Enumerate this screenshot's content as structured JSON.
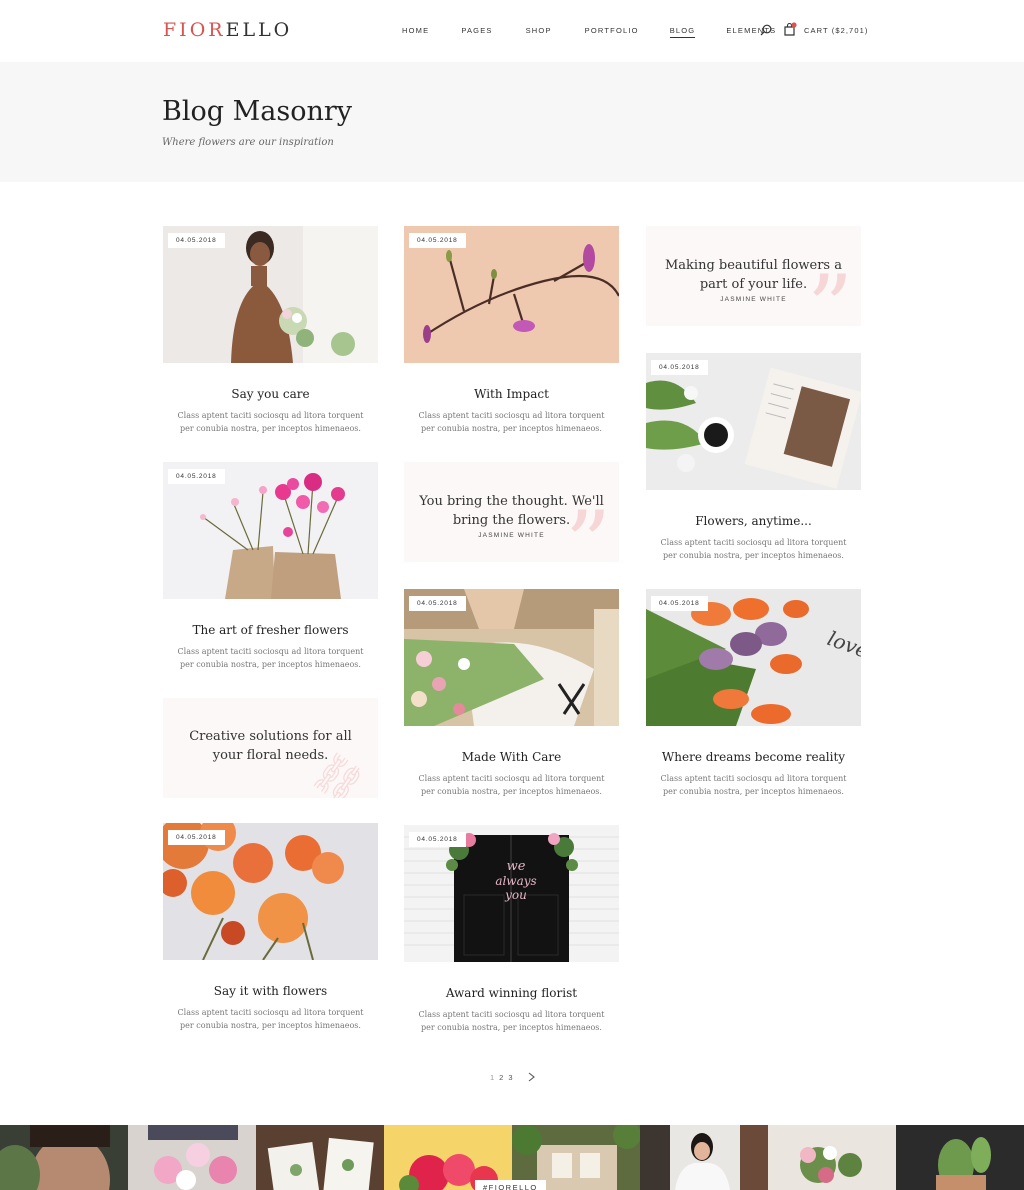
{
  "header": {
    "logo_accent": "FIOR",
    "logo_rest": "ELLO",
    "nav": [
      "HOME",
      "PAGES",
      "SHOP",
      "PORTFOLIO",
      "BLOG",
      "ELEMENTS"
    ],
    "cart_label": "CART ($2,701)"
  },
  "title_band": {
    "title": "Blog Masonry",
    "subtitle": "Where flowers are our inspiration"
  },
  "date": "04.05.2018",
  "excerpt": "Class aptent taciti sociosqu ad litora torquent per conubia nostra, per inceptos himenaeos.",
  "posts": [
    {
      "title": "Say you care",
      "date": "04.05.2018"
    },
    {
      "title": "With Impact",
      "date": "04.05.2018"
    },
    {
      "title": "Flowers, anytime...",
      "date": "04.05.2018"
    },
    {
      "title": "The art of fresher flowers",
      "date": "04.05.2018"
    },
    {
      "title": "Made With Care",
      "date": "04.05.2018"
    },
    {
      "title": "Where dreams become reality",
      "date": "04.05.2018"
    },
    {
      "title": "Say it with flowers",
      "date": "04.05.2018"
    },
    {
      "title": "Award winning florist",
      "date": "04.05.2018"
    }
  ],
  "quotes": [
    {
      "text": "Making beautiful flowers a part of your life.",
      "author": "JASMINE WHITE"
    },
    {
      "text": "You bring the thought. We'll bring the flowers.",
      "author": "JASMINE WHITE"
    }
  ],
  "link_post": {
    "text": "Creative solutions for all your floral needs."
  },
  "pagination": {
    "pages": [
      "1",
      "2",
      "3"
    ]
  },
  "instagram_tag": "#FIORELLO",
  "colors": {
    "accent": "#d9534f",
    "band_bg": "#f7f7f7",
    "quote_bg": "#fcf8f7"
  }
}
